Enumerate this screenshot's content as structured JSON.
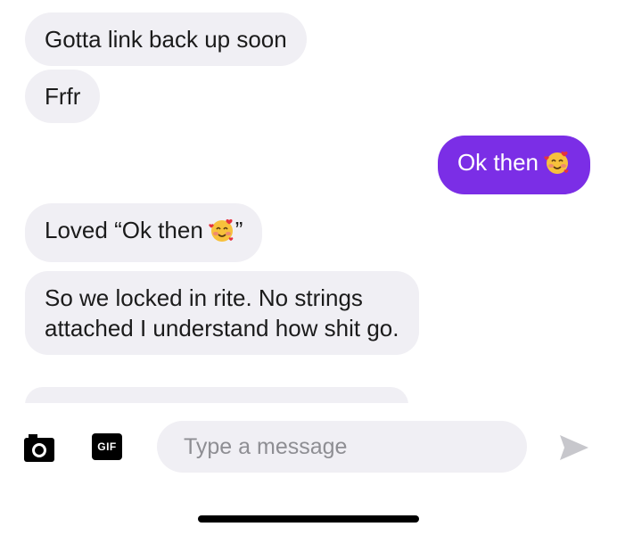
{
  "messages": [
    {
      "direction": "incoming",
      "text": "Gotta link back up soon"
    },
    {
      "direction": "incoming",
      "text": "Frfr"
    },
    {
      "direction": "outgoing",
      "text": "Ok then",
      "emoji": "smiling-face-with-hearts"
    },
    {
      "direction": "incoming",
      "text_before": "Loved “Ok then",
      "emoji": "smiling-face-with-hearts",
      "text_after": "”"
    },
    {
      "direction": "incoming",
      "text": "So we locked in rite. No strings attached I understand how shit go."
    }
  ],
  "composer": {
    "camera_icon": "camera-icon",
    "gif_label": "GIF",
    "placeholder": "Type a message",
    "value": "",
    "send_icon": "send-icon"
  },
  "colors": {
    "incoming_bubble": "#f0eff4",
    "outgoing_bubble": "#7b2ee6",
    "placeholder": "#8e8e93",
    "send_icon": "#c7c7cc"
  }
}
